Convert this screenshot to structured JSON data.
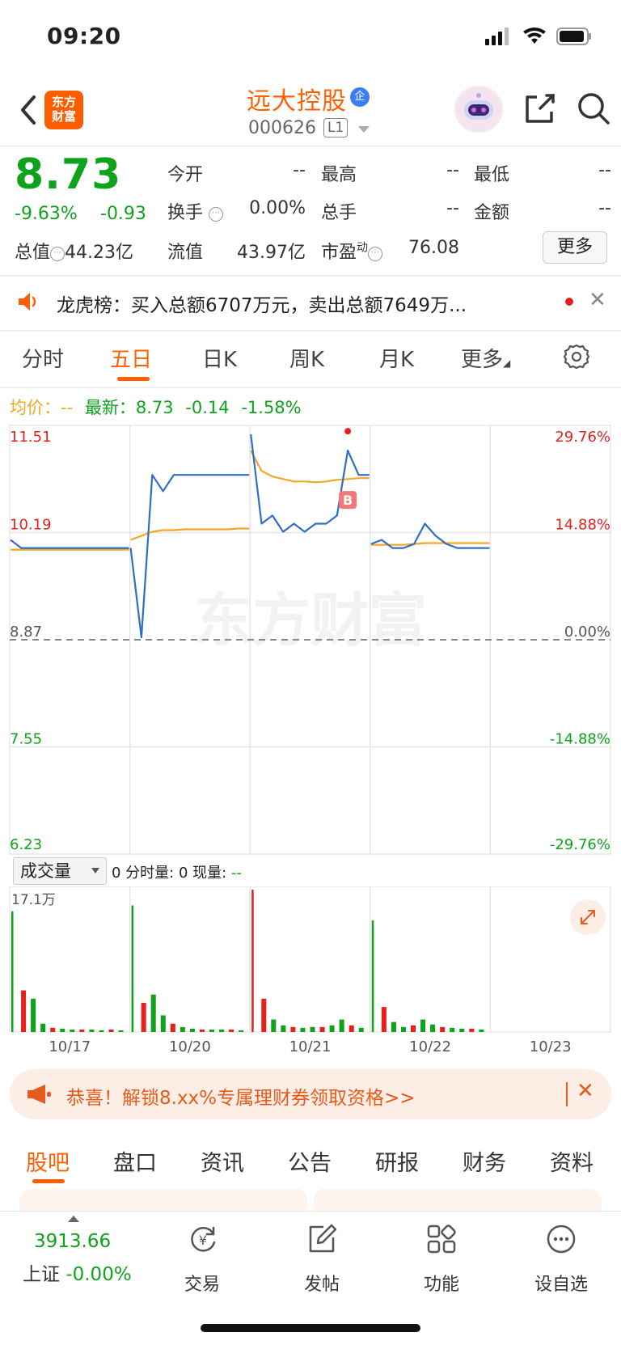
{
  "status": {
    "time": "09:20"
  },
  "header": {
    "logo": [
      "东方",
      "财富"
    ],
    "name": "远大控股",
    "badge": "企",
    "code": "000626",
    "level": "L1"
  },
  "quote": {
    "price": "8.73",
    "change_pct": "-9.63%",
    "change": "-0.93",
    "open_label": "今开",
    "open": "--",
    "high_label": "最高",
    "high": "--",
    "low_label": "最低",
    "low": "--",
    "turnover_label": "换手",
    "turnover": "0.00%",
    "vol_label": "总手",
    "vol": "--",
    "amount_label": "金额",
    "amount": "--",
    "mktcap_label": "总值",
    "mktcap": "44.23亿",
    "float_label": "流值",
    "float": "43.97亿",
    "pe_label": "市盈",
    "pe_sup": "动",
    "pe": "76.08",
    "more": "更多"
  },
  "lhb": {
    "text": "龙虎榜：买入总额6707万元，卖出总额7649万..."
  },
  "tabs": {
    "items": [
      "分时",
      "五日",
      "日K",
      "周K",
      "月K",
      "更多"
    ],
    "active": 1
  },
  "legend": {
    "avg_label": "均价：",
    "avg": "--",
    "latest_label": "最新：",
    "latest": "8.73",
    "chg": "-0.14",
    "chg_pct": "-1.58%"
  },
  "chart_data": {
    "type": "line",
    "title": "",
    "x_labels": [
      "10/17",
      "10/20",
      "10/21",
      "10/22",
      "10/23"
    ],
    "y_left_ticks": [
      "11.51",
      "10.19",
      "8.87",
      "7.55",
      "6.23"
    ],
    "y_right_ticks": [
      "29.76%",
      "14.88%",
      "0.00%",
      "-14.88%",
      "-29.76%"
    ],
    "ylim": [
      6.23,
      11.51
    ],
    "base": 8.87,
    "watermark": "东方财富",
    "marker": "B",
    "series": [
      {
        "color": "#2f6ec2",
        "days": [
          [
            10.1,
            10.0,
            10.0,
            10.0,
            10.0,
            10.0,
            10.0,
            10.0,
            10.0,
            10.0,
            10.0,
            10.0
          ],
          [
            10.0,
            8.9,
            10.9,
            10.7,
            10.9,
            10.9,
            10.9,
            10.9,
            10.9,
            10.9,
            10.9,
            10.9
          ],
          [
            11.4,
            10.3,
            10.4,
            10.2,
            10.3,
            10.2,
            10.3,
            10.3,
            10.4,
            11.2,
            10.9,
            10.9
          ],
          [
            10.05,
            10.1,
            10.0,
            10.0,
            10.05,
            10.3,
            10.15,
            10.05,
            10.0,
            10.0,
            10.0,
            10.0
          ]
        ]
      },
      {
        "color": "#f5a623",
        "days": [
          [
            9.98,
            9.98,
            9.98,
            9.98,
            9.98,
            9.98,
            9.98,
            9.98,
            9.98,
            9.98,
            9.98,
            9.98
          ],
          [
            10.1,
            10.15,
            10.2,
            10.22,
            10.22,
            10.23,
            10.23,
            10.23,
            10.23,
            10.23,
            10.24,
            10.24
          ],
          [
            11.2,
            10.95,
            10.88,
            10.85,
            10.82,
            10.82,
            10.81,
            10.82,
            10.84,
            10.85,
            10.86,
            10.86
          ],
          [
            10.04,
            10.04,
            10.04,
            10.04,
            10.05,
            10.06,
            10.06,
            10.06,
            10.06,
            10.06,
            10.06,
            10.06
          ]
        ]
      }
    ]
  },
  "volume": {
    "label": "成交量",
    "info_a": "0 分时量: 0 现量:",
    "info_b": "--",
    "max_label": "17.1万",
    "max": 17.1,
    "days": [
      [
        14.5,
        5,
        4,
        1,
        0.5,
        0.4,
        0.3,
        0.3,
        0.3,
        0.2,
        0.3,
        0.2
      ],
      [
        15.2,
        3.5,
        4.5,
        2,
        1,
        0.6,
        0.4,
        0.3,
        0.3,
        0.3,
        0.3,
        0.2
      ],
      [
        17.1,
        4,
        1.5,
        0.8,
        0.6,
        0.5,
        0.6,
        0.6,
        0.8,
        1.5,
        0.8,
        0.5
      ],
      [
        13.4,
        3,
        1.2,
        0.6,
        0.8,
        1.5,
        0.9,
        0.6,
        0.5,
        0.4,
        0.4,
        0.3
      ]
    ]
  },
  "promo": {
    "text": "恭喜！解锁8.xx%专属理财券领取资格>>"
  },
  "bottom_tabs": {
    "items": [
      "股吧",
      "盘口",
      "资讯",
      "公告",
      "研报",
      "财务",
      "资料"
    ]
  },
  "bottom_nav": {
    "index_value": "3913.66",
    "index_label": "上证",
    "index_chg": "-0.00%",
    "items": [
      "交易",
      "发帖",
      "功能",
      "设自选"
    ]
  }
}
